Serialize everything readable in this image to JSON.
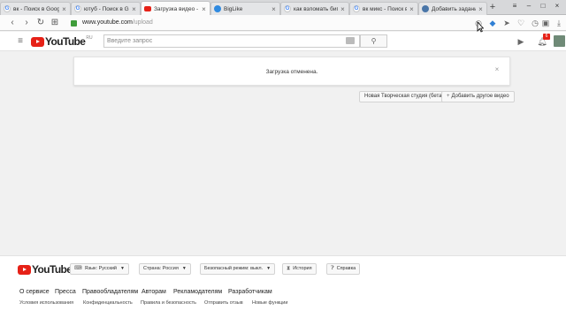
{
  "browser": {
    "tabs": [
      {
        "title": "вк - Поиск в Google",
        "favicon": "google-icon"
      },
      {
        "title": "ютуб - Поиск в Google",
        "favicon": "google-icon"
      },
      {
        "title": "Загрузка видео - YouTube",
        "favicon": "youtube-icon",
        "active": true
      },
      {
        "title": "BigLike",
        "favicon": "biglike-icon"
      },
      {
        "title": "как взломать биглайк",
        "favicon": "google-icon"
      },
      {
        "title": "вк микс - Поиск в Google",
        "favicon": "google-icon"
      },
      {
        "title": "Добавить задание",
        "favicon": "vk-icon"
      }
    ],
    "new_tab": "+",
    "url_host": "www.youtube.com",
    "url_path": "/upload"
  },
  "masthead": {
    "logo_text": "YouTube",
    "country": "RU",
    "search_placeholder": "Введите запрос",
    "notification_count": "6"
  },
  "main": {
    "notice": "Загрузка отменена.",
    "studio_button": "Новая Творческая студия (бета)",
    "add_video_button": "Добавить другое видео"
  },
  "footer": {
    "logo_text": "YouTube",
    "language": "Язык: Русский",
    "country": "Страна: Россия",
    "safety": "Безопасный режим: выкл.",
    "history": "История",
    "help": "Справка",
    "primary_links": [
      "О сервисе",
      "Пресса",
      "Правообладателям",
      "Авторам",
      "Рекламодателям",
      "Разработчикам"
    ],
    "secondary_links": [
      "Условия использования",
      "Конфиденциальность",
      "Правила и безопасность",
      "Отправить отзыв",
      "Новые функции"
    ]
  },
  "colors": {
    "brand_red": "#e62117",
    "page_bg": "#f1f1f1"
  }
}
